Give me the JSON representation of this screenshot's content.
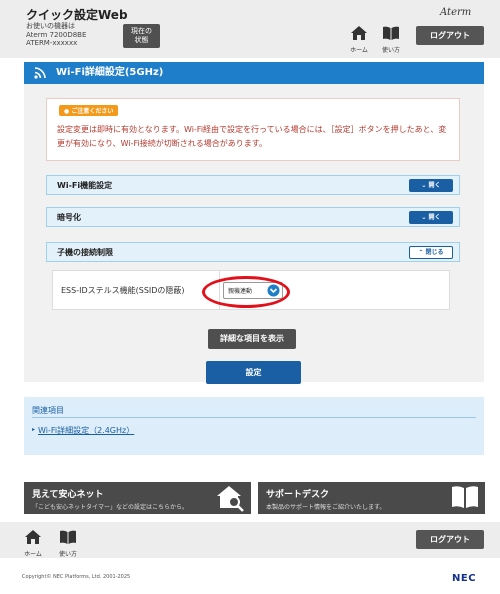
{
  "header": {
    "app_title": "クイック設定Web",
    "device_label": "お使いの機器は",
    "device_model": "Aterm 7200D8BE",
    "device_serial": "ATERM-xxxxxx",
    "status_button": "現在の\n状態",
    "logo": "Aterm",
    "home_label": "ホーム",
    "guide_label": "使い方",
    "logout_label": "ログアウト"
  },
  "page": {
    "title": "Wi-Fi詳細設定(5GHz)"
  },
  "caution": {
    "badge": "ご注意ください",
    "text": "設定変更は即時に有効となります。Wi-Fi経由で設定を行っている場合には、［設定］ボタンを押したあと、変更が有効になり、Wi-Fi接続が切断される場合があります。"
  },
  "sections": [
    {
      "label": "Wi-Fi機能設定",
      "button": "開く",
      "state": "closed"
    },
    {
      "label": "暗号化",
      "button": "開く",
      "state": "closed"
    },
    {
      "label": "子機の接続制限",
      "button": "閉じる",
      "state": "open"
    }
  ],
  "setting": {
    "label": "ESS-IDステルス機能(SSIDの隠蔽)",
    "value": "親機連動"
  },
  "buttons": {
    "detail": "詳細な項目を表示",
    "submit": "設定"
  },
  "related": {
    "title": "関連項目",
    "link": "Wi-Fi詳細設定（2.4GHz）"
  },
  "banners": {
    "left_title": "見えて安心ネット",
    "left_sub": "「こども安心ネットタイマー」などの設定はこちらから。",
    "right_title": "サポートデスク",
    "right_sub": "本製品のサポート情報をご紹介いたします。"
  },
  "footer": {
    "home_label": "ホーム",
    "guide_label": "使い方",
    "logout_label": "ログアウト",
    "copyright": "Copyright© NEC Platforms, Ltd. 2001-2025",
    "brand": "NEC"
  },
  "colors": {
    "primary": "#1f7ec9",
    "button_blue": "#1a5fa3",
    "caution_text": "#b53a2f",
    "highlight": "#e2101a"
  }
}
